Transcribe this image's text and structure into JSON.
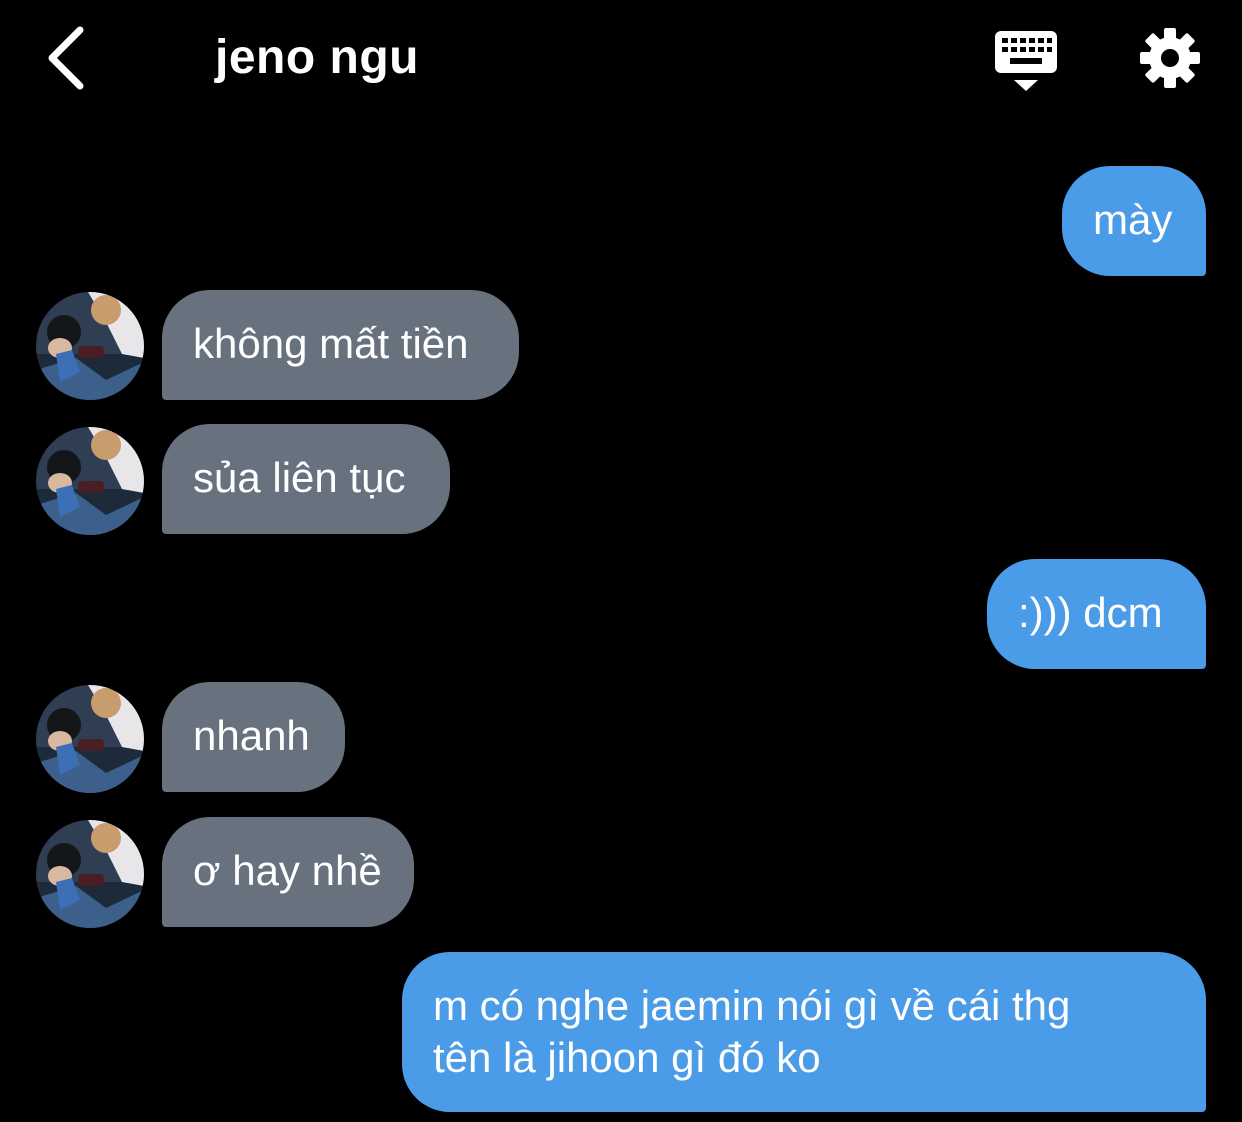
{
  "header": {
    "title": "jeno ngu",
    "back_icon": "chevron-left-icon",
    "keyboard_icon": "keyboard-icon",
    "settings_icon": "gear-icon"
  },
  "colors": {
    "background": "#000000",
    "sent_bubble": "#4a9be8",
    "received_bubble": "#67727e",
    "text": "#ffffff"
  },
  "messages": [
    {
      "side": "sent",
      "text": "mày"
    },
    {
      "side": "received",
      "text": "không mất tiền"
    },
    {
      "side": "received",
      "text": "sủa liên tục"
    },
    {
      "side": "sent",
      "text": ":))) dcm"
    },
    {
      "side": "received",
      "text": "nhanh"
    },
    {
      "side": "received",
      "text": "ơ hay nhề"
    },
    {
      "side": "sent",
      "text": "m có nghe jaemin nói gì về cái thg tên là jihoon gì đó ko"
    }
  ]
}
